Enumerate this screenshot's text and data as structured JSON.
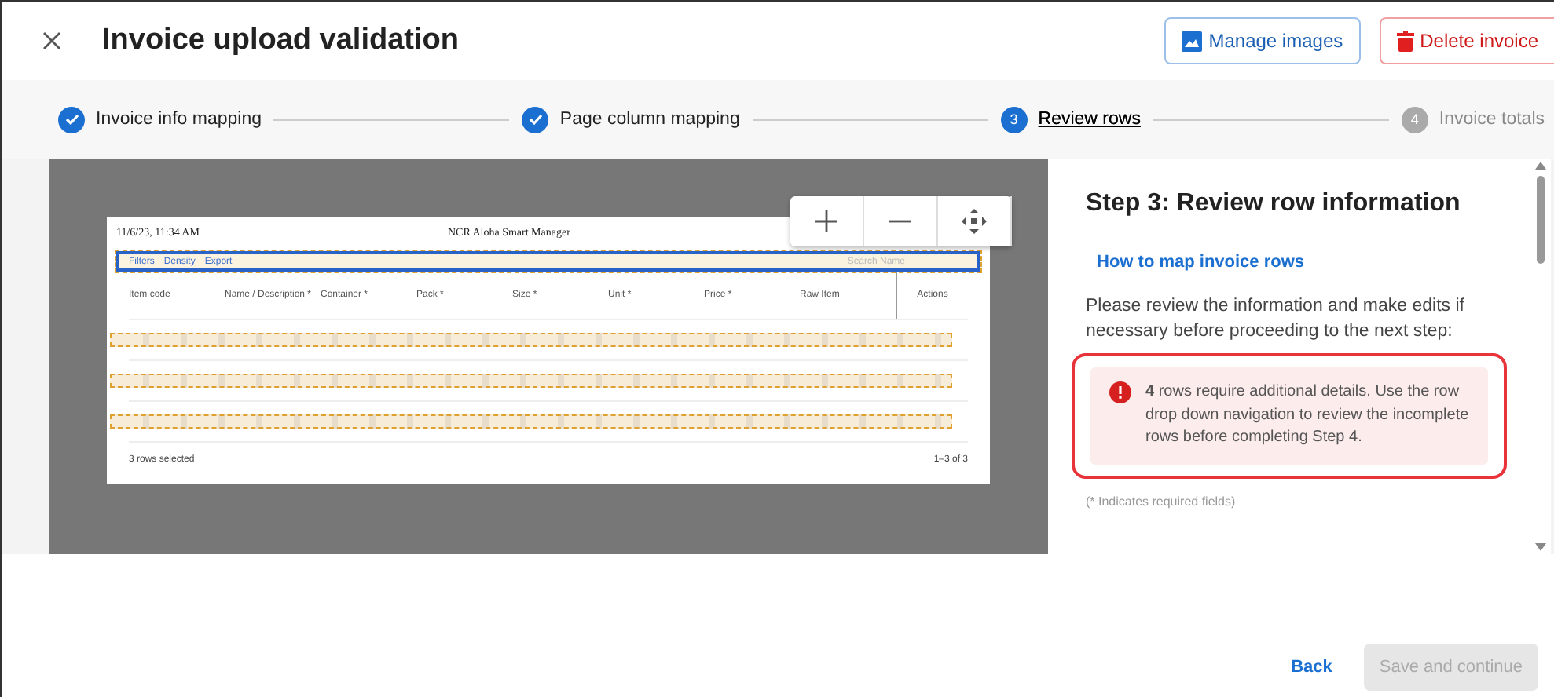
{
  "header": {
    "title": "Invoice upload validation",
    "buttons": [
      {
        "label": "Manage images",
        "kind": "primary"
      },
      {
        "label": "Delete invoice",
        "kind": "danger"
      }
    ]
  },
  "steps": [
    {
      "label": "Invoice info mapping",
      "done": true,
      "selected": false
    },
    {
      "label": "Page column mapping",
      "done": true,
      "selected": false
    },
    {
      "label": "Review rows",
      "number": "3",
      "done": false,
      "selected": true
    },
    {
      "label": "Invoice totals",
      "number": "4",
      "done": false,
      "selected": false
    }
  ],
  "preview": {
    "date": "11/6/23, 11:34 AM",
    "title": "NCR Aloha Smart Manager",
    "toolbar": [
      "Filters",
      "Density",
      "Export"
    ],
    "search_placeholder": "Search Name",
    "columns": [
      "Item code",
      "Name / Description *",
      "Container *",
      "Pack *",
      "Size *",
      "Unit *",
      "Price *",
      "Raw Item",
      "Actions"
    ],
    "rows": [
      {
        "kind": "unreadable"
      },
      {
        "kind": "unreadable"
      },
      {
        "kind": "unreadable"
      }
    ],
    "footer_left": "3 rows selected",
    "footer_right": "1–3 of 3"
  },
  "panel": {
    "heading": "Step 3: Review row information",
    "link": "How to map invoice rows",
    "text": "Please review the information and make edits if necessary before proceeding to the next step:",
    "alert": "**4** rows require additional details. Use the row drop down navigation to review the incomplete rows before completing Step 4.",
    "note": "(* Indicates required fields)"
  },
  "footer": {
    "back": "Back",
    "save": {
      "label": "Save and continue",
      "disabled": true
    }
  }
}
